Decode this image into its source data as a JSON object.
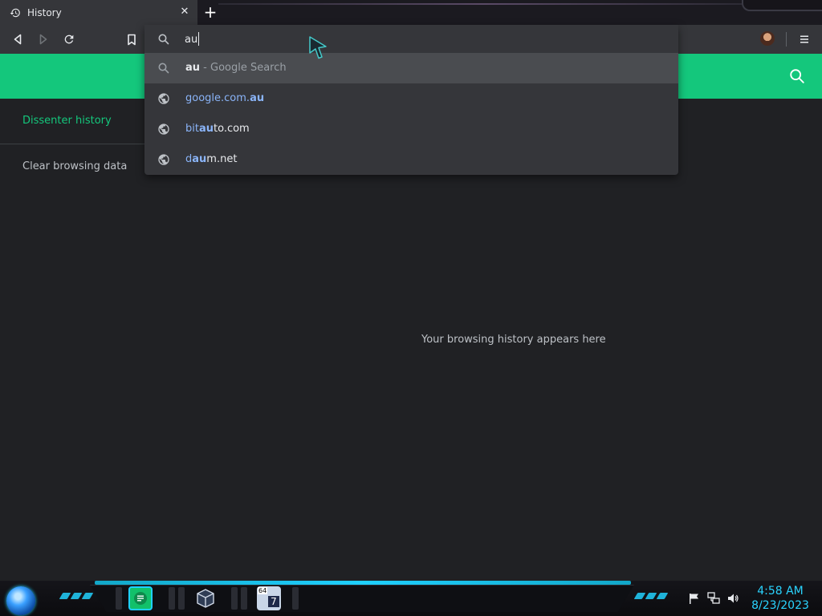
{
  "tab": {
    "title": "History",
    "close_glyph": "✕",
    "new_tab_glyph": "+",
    "icon": "history-icon"
  },
  "toolbar": {
    "back_icon": "back-icon",
    "forward_icon": "forward-icon",
    "reload_icon": "reload-icon",
    "bookmark_icon": "bookmark-icon",
    "menu_icon": "menu-icon"
  },
  "omnibox": {
    "value": "au",
    "suggestions": [
      {
        "query": "au",
        "suffix": "- Google Search",
        "icon": "search-icon"
      },
      {
        "prefix": "google.com.",
        "match": "au",
        "suffix": "",
        "icon": "globe-icon"
      },
      {
        "prefix": "bit",
        "match": "au",
        "suffix": "to.com",
        "icon": "globe-icon"
      },
      {
        "prefix": "d",
        "match": "au",
        "suffix": "m.net",
        "icon": "globe-icon"
      }
    ]
  },
  "sidebar": {
    "items": [
      {
        "label": "Dissenter history",
        "active": true
      },
      {
        "label": "Clear browsing data",
        "active": false
      }
    ]
  },
  "main": {
    "empty_message": "Your browsing history appears here"
  },
  "taskbar": {
    "time": "4:58 AM",
    "date": "8/23/2023",
    "badge_64": "64",
    "badge_7": "7"
  },
  "colors": {
    "accent_green": "#14c77c",
    "link_blue": "#8ab4f8",
    "clock_cyan": "#2ad4ff"
  }
}
